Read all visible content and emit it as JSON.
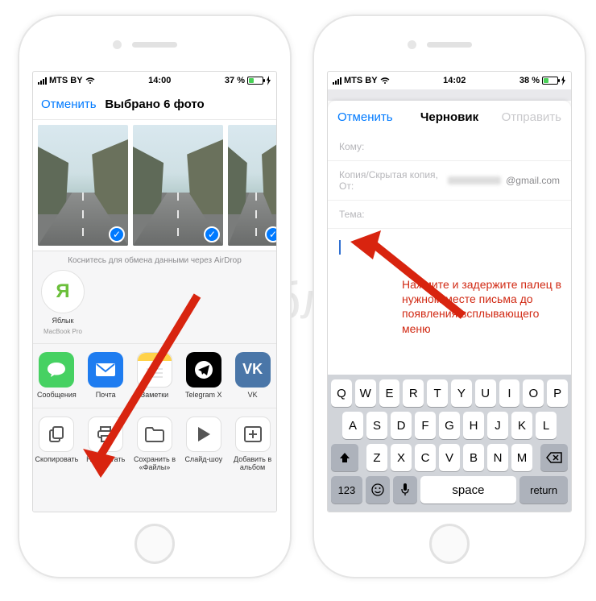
{
  "watermark": "Яблык",
  "phone_left": {
    "status": {
      "carrier": "MTS BY",
      "time": "14:00",
      "battery_pct": "37 %"
    },
    "nav": {
      "cancel": "Отменить",
      "title": "Выбрано 6 фото"
    },
    "airdrop_hint": "Коснитесь для обмена данными через AirDrop",
    "airdrop": {
      "name": "Яблык",
      "device": "MacBook Pro"
    },
    "apps": [
      {
        "label": "Сообщения"
      },
      {
        "label": "Почта"
      },
      {
        "label": "Заметки"
      },
      {
        "label": "Telegram X"
      },
      {
        "label": "VK"
      }
    ],
    "actions": [
      {
        "label": "Скопировать"
      },
      {
        "label": "Напечатать"
      },
      {
        "label": "Сохранить в «Файлы»"
      },
      {
        "label": "Слайд-шоу"
      },
      {
        "label": "Добавить в альбом"
      }
    ]
  },
  "phone_right": {
    "status": {
      "carrier": "MTS BY",
      "time": "14:02",
      "battery_pct": "38 %"
    },
    "nav": {
      "cancel": "Отменить",
      "title": "Черновик",
      "send": "Отправить"
    },
    "fields": {
      "to_label": "Кому:",
      "cc_label": "Копия/Скрытая копия, От:",
      "from_suffix": "@gmail.com",
      "subject_label": "Тема:"
    },
    "instruction": "Нажмите и задержите палец в нужном месте письма до появления всплывающего меню",
    "keyboard": {
      "row1": [
        "Q",
        "W",
        "E",
        "R",
        "T",
        "Y",
        "U",
        "I",
        "O",
        "P"
      ],
      "row2": [
        "A",
        "S",
        "D",
        "F",
        "G",
        "H",
        "J",
        "K",
        "L"
      ],
      "row3": [
        "Z",
        "X",
        "C",
        "V",
        "B",
        "N",
        "M"
      ],
      "numkey": "123",
      "space": "space",
      "return": "return"
    }
  }
}
